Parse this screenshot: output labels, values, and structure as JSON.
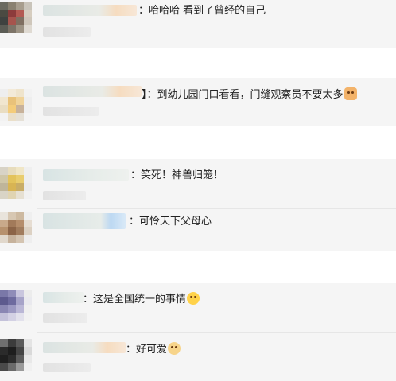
{
  "comments": [
    {
      "text": "：哈哈哈  看到了曾经的自己",
      "emoji": ""
    },
    {
      "text": "】：到幼儿园门口看看，门缝观察员不要太多",
      "emoji": "cat-face-icon"
    },
    {
      "text": "：笑死！神兽归笼！",
      "emoji": ""
    },
    {
      "text": "：可怜天下父母心",
      "emoji": ""
    },
    {
      "text": "：这是全国统一的事情",
      "emoji": "laughing-face-icon"
    },
    {
      "text": "：好可爱",
      "emoji": "dog-face-icon"
    }
  ],
  "colors": {
    "card_background": "#f5f5f5",
    "text": "#222222"
  }
}
